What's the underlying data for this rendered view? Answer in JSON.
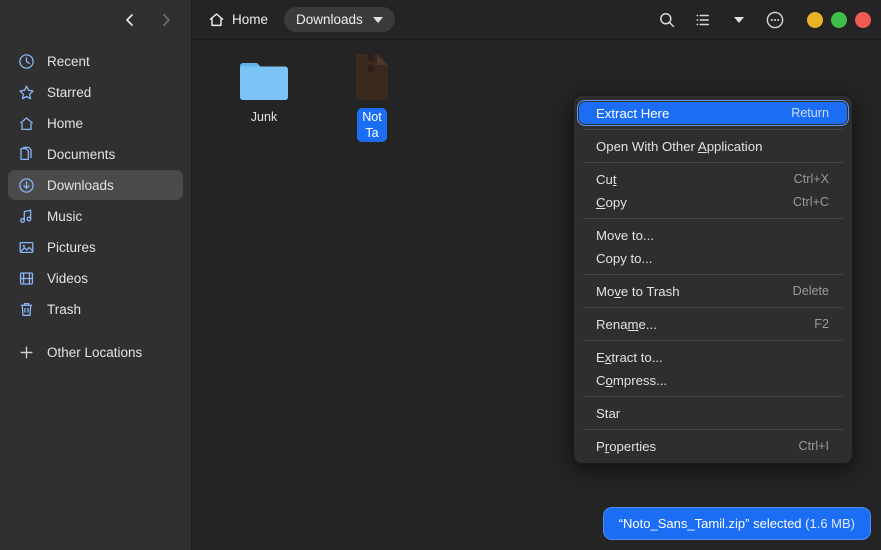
{
  "sidebar": {
    "nav": {
      "back_icon": "chevron-left-icon",
      "forward_icon": "chevron-right-icon"
    },
    "items": [
      {
        "label": "Recent",
        "icon": "clock-icon",
        "selected": false
      },
      {
        "label": "Starred",
        "icon": "star-icon",
        "selected": false
      },
      {
        "label": "Home",
        "icon": "home-icon",
        "selected": false
      },
      {
        "label": "Documents",
        "icon": "documents-icon",
        "selected": false
      },
      {
        "label": "Downloads",
        "icon": "download-icon",
        "selected": true
      },
      {
        "label": "Music",
        "icon": "music-icon",
        "selected": false
      },
      {
        "label": "Pictures",
        "icon": "pictures-icon",
        "selected": false
      },
      {
        "label": "Videos",
        "icon": "videos-icon",
        "selected": false
      },
      {
        "label": "Trash",
        "icon": "trash-icon",
        "selected": false
      }
    ],
    "other_locations": {
      "label": "Other Locations",
      "icon": "plus-icon"
    }
  },
  "header": {
    "home_label": "Home",
    "home_icon": "home-icon",
    "path_button": "Downloads",
    "path_caret_icon": "chevron-down-icon",
    "search_icon": "search-icon",
    "view_list_icon": "list-view-icon",
    "view_caret_icon": "chevron-down-icon",
    "menu_icon": "more-options-icon",
    "window_buttons": [
      {
        "name": "minimize",
        "color": "#e8b424"
      },
      {
        "name": "maximize",
        "color": "#3fc04a"
      },
      {
        "name": "close",
        "color": "#ee5b52"
      }
    ]
  },
  "files": [
    {
      "name": "Junk",
      "icon": "folder-icon",
      "selected": false
    },
    {
      "name": "Noto_Sans_Tamil.zip",
      "display": "Not\nTa",
      "icon": "archive-icon",
      "selected": true
    }
  ],
  "context_menu": {
    "groups": [
      [
        {
          "label": "Extract Here",
          "accel": "Return",
          "highlight": true,
          "mnemonic": ""
        }
      ],
      [
        {
          "label": "Open With Other Application",
          "accel": "",
          "mnemonic": "A"
        }
      ],
      [
        {
          "label": "Cut",
          "accel": "Ctrl+X",
          "mnemonic": "t"
        },
        {
          "label": "Copy",
          "accel": "Ctrl+C",
          "mnemonic": "C"
        }
      ],
      [
        {
          "label": "Move to...",
          "accel": "",
          "mnemonic": ""
        },
        {
          "label": "Copy to...",
          "accel": "",
          "mnemonic": ""
        }
      ],
      [
        {
          "label": "Move to Trash",
          "accel": "Delete",
          "mnemonic": "v"
        }
      ],
      [
        {
          "label": "Rename...",
          "accel": "F2",
          "mnemonic": "m"
        }
      ],
      [
        {
          "label": "Extract to...",
          "accel": "",
          "mnemonic": "x"
        },
        {
          "label": "Compress...",
          "accel": "",
          "mnemonic": "o"
        }
      ],
      [
        {
          "label": "Star",
          "accel": "",
          "mnemonic": ""
        }
      ],
      [
        {
          "label": "Properties",
          "accel": "Ctrl+I",
          "mnemonic": "r"
        }
      ]
    ]
  },
  "status_toast": {
    "text": "“Noto_Sans_Tamil.zip” selected",
    "size": "(1.6 MB)"
  },
  "colors": {
    "accent": "#1b6ef3",
    "sidebar_bg": "#303030",
    "main_bg": "#242424",
    "menu_bg": "#2e2e2e",
    "icon_blue": "#8ab4f8",
    "folder_blue": "#62b4f0"
  }
}
